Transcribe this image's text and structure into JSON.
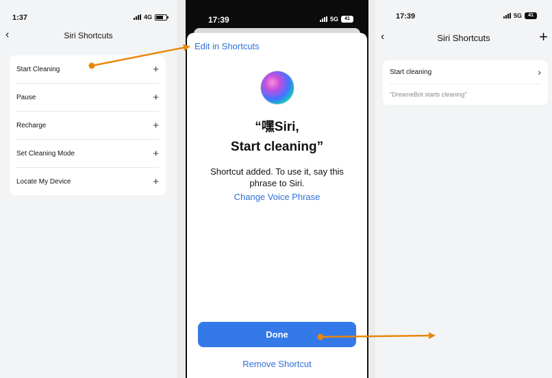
{
  "screen1": {
    "status": {
      "time": "1:37",
      "network": "4G"
    },
    "nav": {
      "back": "‹",
      "title": "Siri Shortcuts"
    },
    "items": [
      {
        "label": "Start Cleaning",
        "action": "+"
      },
      {
        "label": "Pause",
        "action": "+"
      },
      {
        "label": "Recharge",
        "action": "+"
      },
      {
        "label": "Set Cleaning Mode",
        "action": "+"
      },
      {
        "label": "Locate My Device",
        "action": "+"
      }
    ]
  },
  "screen2": {
    "status": {
      "time": "17:39",
      "network": "5G",
      "battery": "41"
    },
    "edit_link": "Edit in Shortcuts",
    "phrase_line1": "“嘿Siri,",
    "phrase_line2": "Start cleaning”",
    "added_text": "Shortcut added. To use it, say this phrase to Siri.",
    "change_link": "Change Voice Phrase",
    "done_label": "Done",
    "remove_link": "Remove Shortcut"
  },
  "screen3": {
    "status": {
      "time": "17:39",
      "network": "5G",
      "battery": "41"
    },
    "nav": {
      "back": "‹",
      "title": "Siri Shortcuts",
      "add": "+"
    },
    "shortcut": {
      "label": "Start cleaning",
      "phrase": "\"DreameBot starts cleaning\""
    }
  },
  "colors": {
    "accent": "#3479e8",
    "link": "#2f6fd6",
    "arrow": "#e8870a"
  }
}
